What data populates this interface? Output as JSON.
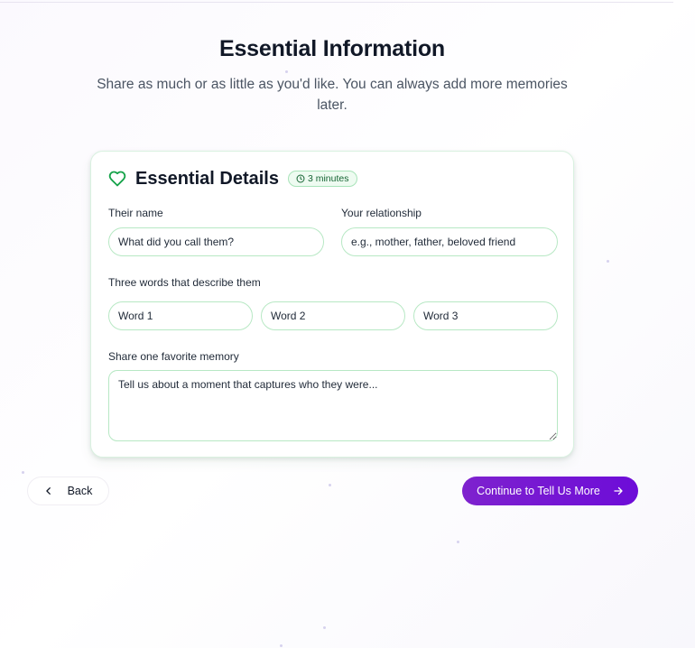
{
  "page": {
    "title": "Essential Information",
    "subtitle": "Share as much or as little as you'd like. You can always add more memories later."
  },
  "card": {
    "title": "Essential Details",
    "badge": "3 minutes",
    "icon": "heart-icon",
    "accent_color": "#16a34a"
  },
  "fields": {
    "name": {
      "label": "Their name",
      "placeholder": "What did you call them?"
    },
    "relationship": {
      "label": "Your relationship",
      "placeholder": "e.g., mother, father, beloved friend"
    },
    "words": {
      "label": "Three words that describe them",
      "placeholders": [
        "Word 1",
        "Word 2",
        "Word 3"
      ]
    },
    "memory": {
      "label": "Share one favorite memory",
      "placeholder": "Tell us about a moment that captures who they were..."
    }
  },
  "nav": {
    "back_label": "Back",
    "continue_label": "Continue to Tell Us More",
    "continue_color": "#7e22ce"
  }
}
